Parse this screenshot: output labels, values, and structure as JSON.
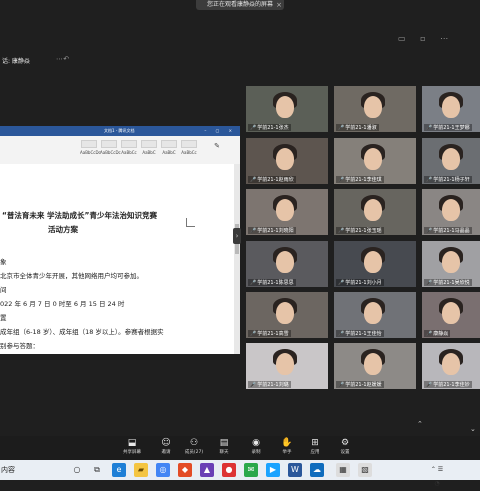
{
  "banner": {
    "text": "您正在观看康静焱的屏幕",
    "close": "×"
  },
  "sharer": {
    "label": "话: 康静焱"
  },
  "document": {
    "window_title": "文档1 - 腾讯文档",
    "ribbon_items": [
      "AaBbCcDc",
      "AaBbCcDc",
      "AaBbCc",
      "AaBbC",
      "AaBbC",
      "AaBbCc"
    ],
    "lines": {
      "title1": "“普法育未来 学法助成长”青少年法治知识竞赛",
      "title2": "活动方案",
      "l1": "象",
      "l2": "北京市全体青少年开展，其他网络用户均可参加。",
      "l3": "间",
      "l4": "022 年 6 月 7 日 0 时至 6 月 15 日 24 时",
      "l5": "置",
      "l6": "成年组（6-18 岁）、成年组（18 岁以上）。参赛者根据实",
      "l7": "别参与答题："
    }
  },
  "participants": [
    {
      "name": "学前21-1张杰"
    },
    {
      "name": "学前21-1潘淑"
    },
    {
      "name": "学前21-1王梦娜"
    },
    {
      "name": "学前21-1赵雨欣"
    },
    {
      "name": "学前21-1李佳琪"
    },
    {
      "name": "学前21-1杨子轩"
    },
    {
      "name": "学前21-1刘晓阳"
    },
    {
      "name": "学前21-1张玉瑶"
    },
    {
      "name": "学前21-1马晶晶"
    },
    {
      "name": "学前21-1陈思思"
    },
    {
      "name": "学前21-1刘小月"
    },
    {
      "name": "学前21-1吴欣悦"
    },
    {
      "name": "学前21-1高雪"
    },
    {
      "name": "学前21-1王佳怡"
    },
    {
      "name": "康静焱"
    },
    {
      "name": "学前21-1刘璐"
    },
    {
      "name": "学前21-1赵媛媛"
    },
    {
      "name": "学前21-1李佳妙"
    }
  ],
  "toolbar": {
    "items": [
      {
        "label": "共享屏幕",
        "icon": "share-screen-icon"
      },
      {
        "label": "邀请",
        "icon": "invite-icon"
      },
      {
        "label": "成员(27)",
        "icon": "members-icon"
      },
      {
        "label": "聊天",
        "icon": "chat-icon"
      },
      {
        "label": "录制",
        "icon": "record-icon"
      },
      {
        "label": "举手",
        "icon": "raise-hand-icon"
      },
      {
        "label": "应用",
        "icon": "apps-icon"
      },
      {
        "label": "设置",
        "icon": "settings-icon"
      }
    ]
  },
  "taskbar": {
    "search_text": "内容"
  },
  "colors": {
    "accent": "#2b579a",
    "background": "#1f1f1f",
    "toolbar": "#1c1c1c"
  }
}
